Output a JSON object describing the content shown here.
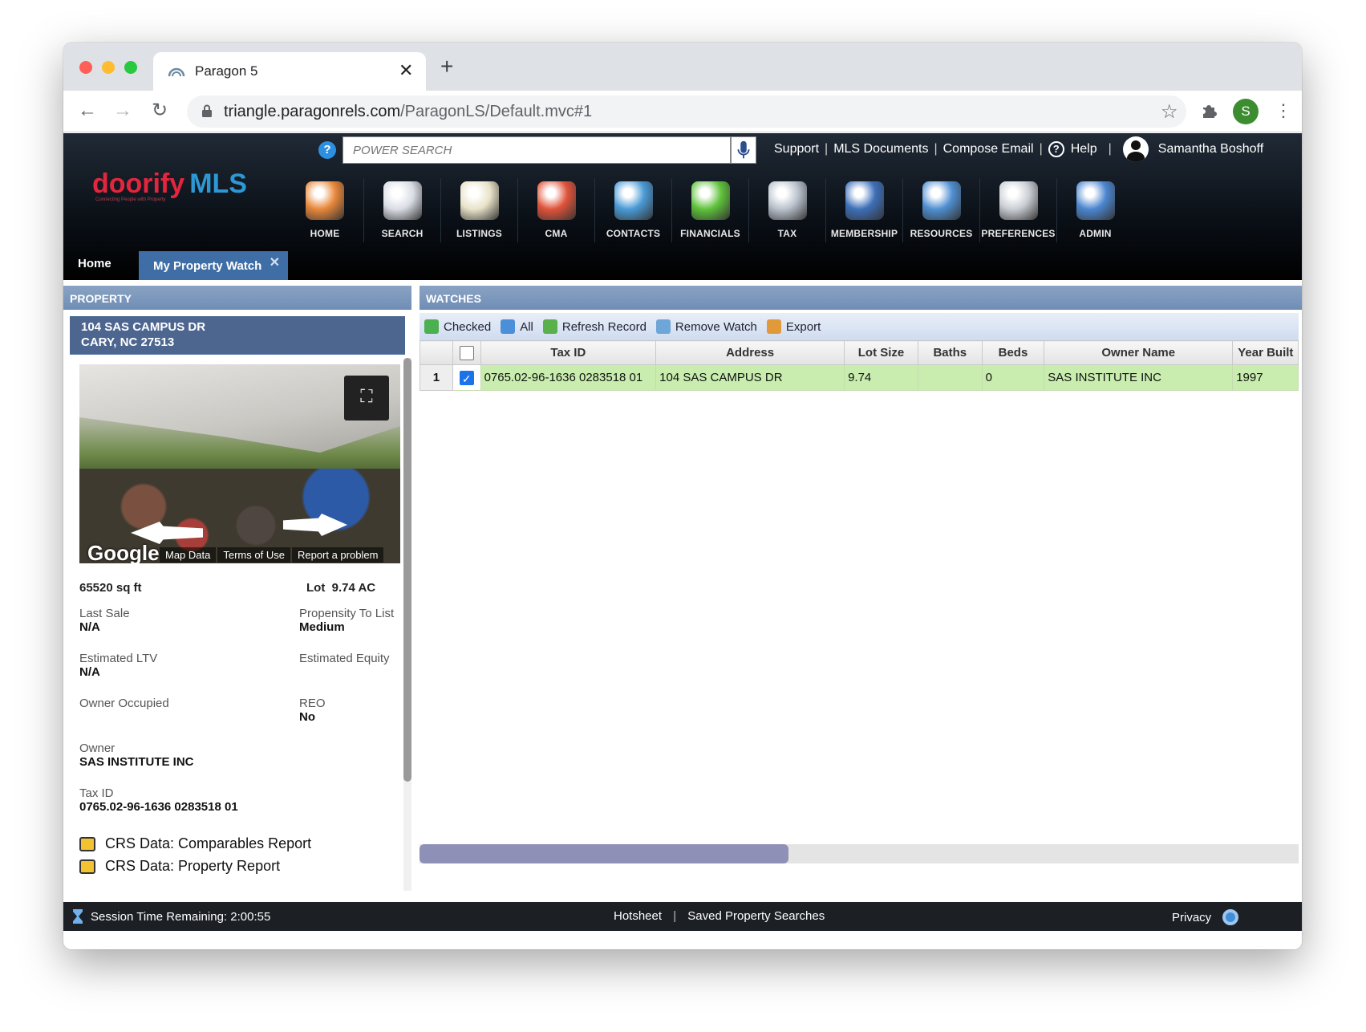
{
  "browser": {
    "tab_title": "Paragon 5",
    "tab_close": "✕",
    "new_tab": "+",
    "url_host": "triangle.paragonrels.com",
    "url_path": "/ParagonLS/Default.mvc#1",
    "profile_initial": "S",
    "back": "←",
    "forward": "→",
    "reload": "↻",
    "star": "☆",
    "menu": "⋮"
  },
  "app": {
    "logo_main": "doorify",
    "logo_mls": "MLS",
    "logo_tagline": "Connecting People with Property",
    "power_search_placeholder": "POWER SEARCH",
    "top_links": [
      "Support",
      "MLS Documents",
      "Compose Email",
      "Help"
    ],
    "user_name": "Samantha Boshoff",
    "nav": [
      {
        "label": "HOME",
        "icon": "home-icon",
        "color": "#e8873a"
      },
      {
        "label": "SEARCH",
        "icon": "search-icon",
        "color": "#d9dde4"
      },
      {
        "label": "LISTINGS",
        "icon": "listings-icon",
        "color": "#e8e2c8"
      },
      {
        "label": "CMA",
        "icon": "cma-icon",
        "color": "#e0533a"
      },
      {
        "label": "CONTACTS",
        "icon": "contacts-icon",
        "color": "#4a9ad6"
      },
      {
        "label": "FINANCIALS",
        "icon": "financials-icon",
        "color": "#5fc23a"
      },
      {
        "label": "TAX",
        "icon": "tax-icon",
        "color": "#b9c1cc"
      },
      {
        "label": "MEMBERSHIP",
        "icon": "membership-icon",
        "color": "#3d6fb8"
      },
      {
        "label": "RESOURCES",
        "icon": "resources-icon",
        "color": "#4f8fd2"
      },
      {
        "label": "PREFERENCES",
        "icon": "preferences-icon",
        "color": "#c9cdd3"
      },
      {
        "label": "ADMIN",
        "icon": "admin-icon",
        "color": "#4b86d0"
      }
    ],
    "breadcrumb_home": "Home",
    "active_tab": "My Property Watch",
    "active_tab_close": "✕"
  },
  "property": {
    "panel_title": "PROPERTY",
    "address_line1": "104 SAS CAMPUS DR",
    "address_line2": "CARY, NC 27513",
    "google_label": "Google",
    "map_links": [
      "Map Data",
      "Terms of Use",
      "Report a problem"
    ],
    "sqft": "65520 sq ft",
    "lot_label": "Lot",
    "lot_value": "9.74 AC",
    "last_sale_label": "Last Sale",
    "last_sale_value": "N/A",
    "propensity_label": "Propensity To List",
    "propensity_value": "Medium",
    "ltv_label": "Estimated LTV",
    "ltv_value": "N/A",
    "equity_label": "Estimated Equity",
    "owner_occupied_label": "Owner Occupied",
    "reo_label": "REO",
    "reo_value": "No",
    "owner_label": "Owner",
    "owner_value": "SAS INSTITUTE INC",
    "tax_id_label": "Tax ID",
    "tax_id_value": "0765.02-96-1636 0283518 01",
    "reports": [
      "CRS Data: Comparables Report",
      "CRS Data: Property Report"
    ]
  },
  "watches": {
    "panel_title": "WATCHES",
    "actions": [
      {
        "label": "Checked",
        "icon": "check-icon",
        "color": "#4caf50"
      },
      {
        "label": "All",
        "icon": "all-arrow-icon",
        "color": "#4a8fd8"
      },
      {
        "label": "Refresh Record",
        "icon": "refresh-icon",
        "color": "#5ab04a"
      },
      {
        "label": "Remove Watch",
        "icon": "remove-watch-icon",
        "color": "#6fa6d8"
      },
      {
        "label": "Export",
        "icon": "export-icon",
        "color": "#e09a3a"
      }
    ],
    "columns": [
      "Tax ID",
      "Address",
      "Lot Size",
      "Baths",
      "Beds",
      "Owner Name",
      "Year Built"
    ],
    "rows": [
      {
        "num": "1",
        "checked": true,
        "tax_id": "0765.02-96-1636 0283518 01",
        "address": "104 SAS CAMPUS DR",
        "lot_size": "9.74",
        "baths": "",
        "beds": "0",
        "owner": "SAS INSTITUTE INC",
        "year_built": "1997"
      }
    ]
  },
  "footer": {
    "session": "Session Time Remaining: 2:00:55",
    "links": [
      "Hotsheet",
      "Saved Property Searches"
    ],
    "privacy": "Privacy"
  }
}
